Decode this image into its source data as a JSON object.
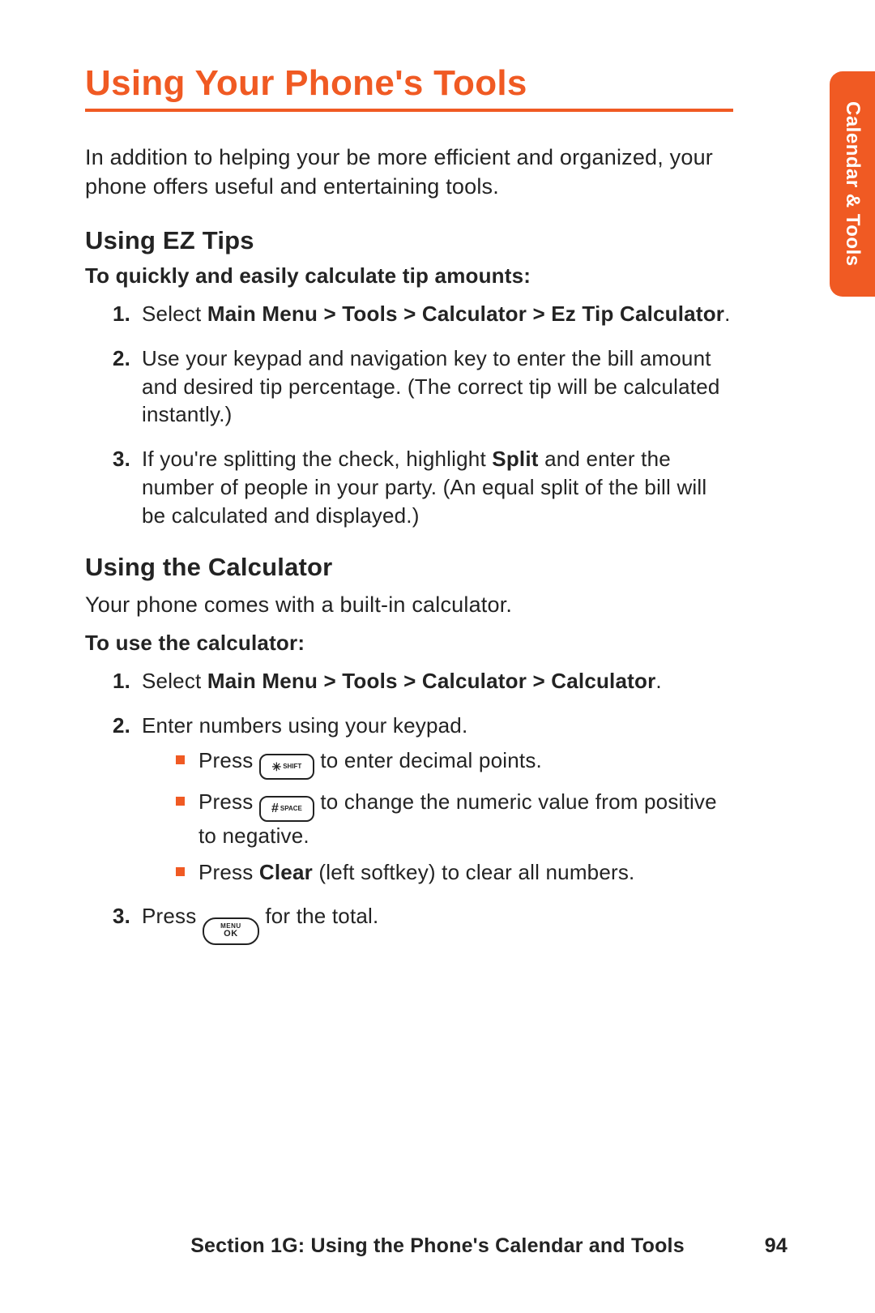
{
  "title": "Using Your Phone's Tools",
  "intro": "In addition to helping your be more efficient and organized, your phone offers useful and entertaining tools.",
  "side_tab": "Calendar & Tools",
  "eztips": {
    "heading": "Using EZ Tips",
    "lead": "To quickly and easily calculate tip amounts:",
    "steps": {
      "s1_pre": "Select ",
      "s1_bold": "Main Menu > Tools > Calculator > Ez Tip Calculator",
      "s1_post": ".",
      "s2": "Use your keypad and navigation key to enter the bill amount and desired tip percentage. (The correct tip will be calculated instantly.)",
      "s3_pre": "If you're splitting the check, highlight ",
      "s3_bold": "Split",
      "s3_post": " and enter the number of people in your party. (An equal split of the bill will be calculated and displayed.)"
    }
  },
  "calc": {
    "heading": "Using the Calculator",
    "intro": "Your phone comes with a built-in calculator.",
    "lead": "To use the calculator:",
    "steps": {
      "s1_pre": "Select ",
      "s1_bold": "Main Menu > Tools > Calculator > Calculator",
      "s1_post": ".",
      "s2": "Enter numbers using your keypad.",
      "b1_pre": "Press ",
      "b1_key_sup": "SHIFT",
      "b1_post": " to enter decimal points.",
      "b2_pre": "Press ",
      "b2_key_sup": "SPACE",
      "b2_post": " to change the numeric value from positive to negative.",
      "b3_pre": "Press ",
      "b3_bold": "Clear",
      "b3_post": " (left softkey) to clear all numbers.",
      "s3_pre": "Press ",
      "s3_key_u": "MENU",
      "s3_key_l": "OK",
      "s3_post": " for the total."
    }
  },
  "footer": {
    "section": "Section 1G: Using the Phone's Calendar and Tools",
    "page": "94"
  }
}
